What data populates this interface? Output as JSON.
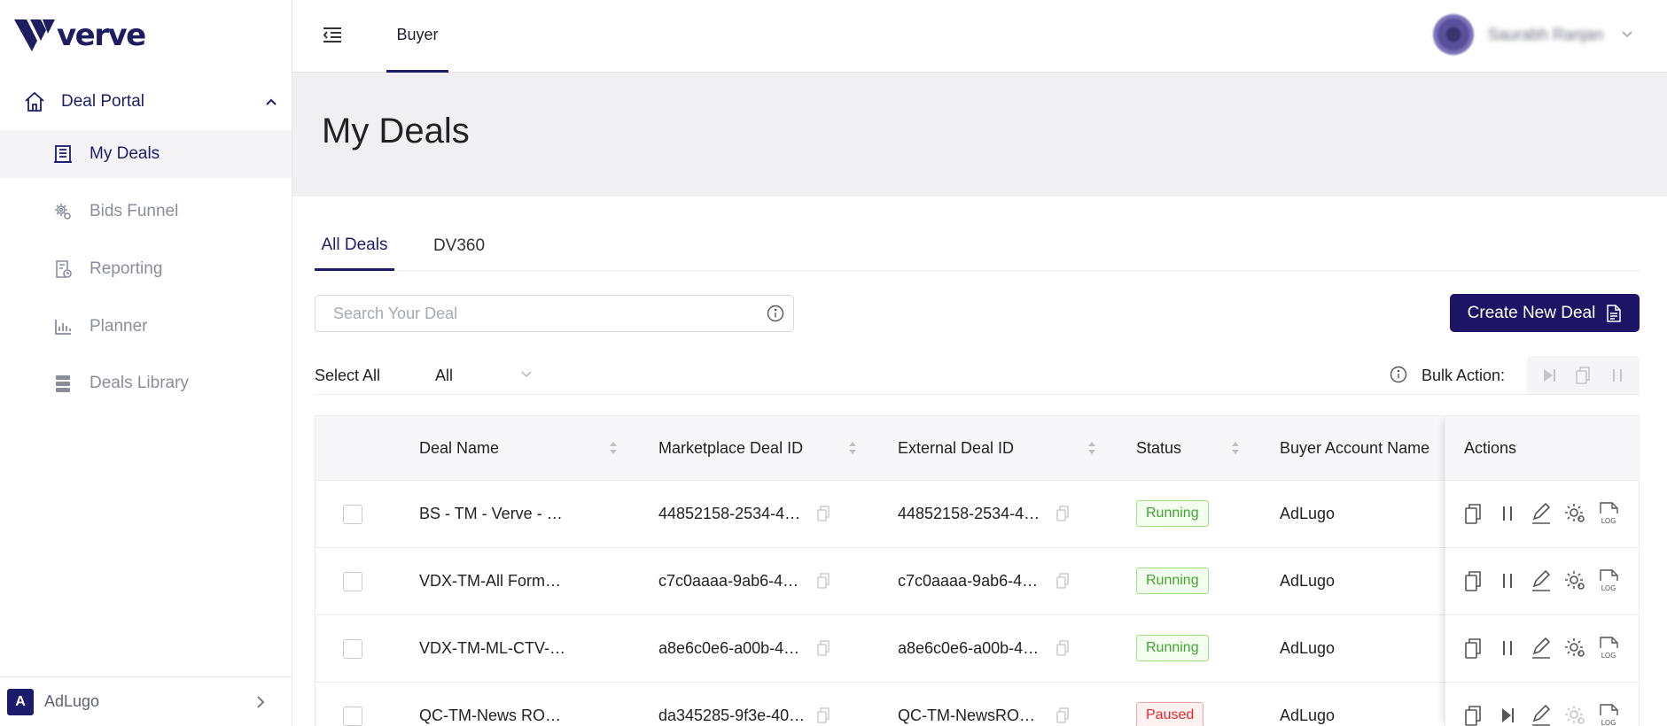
{
  "brand": {
    "name": "verve"
  },
  "sidebar": {
    "section": "Deal Portal",
    "items": [
      {
        "label": "My Deals",
        "icon": "building-icon",
        "active": true
      },
      {
        "label": "Bids Funnel",
        "icon": "gear-cluster-icon",
        "active": false
      },
      {
        "label": "Reporting",
        "icon": "report-icon",
        "active": false
      },
      {
        "label": "Planner",
        "icon": "bar-chart-icon",
        "active": false
      },
      {
        "label": "Deals Library",
        "icon": "server-stack-icon",
        "active": false
      }
    ],
    "account": {
      "initial": "A",
      "name": "AdLugo"
    }
  },
  "topbar": {
    "tab": "Buyer",
    "user_name": "Saurabh Ranjan"
  },
  "page": {
    "title": "My Deals"
  },
  "tabs": [
    {
      "label": "All Deals",
      "active": true
    },
    {
      "label": "DV360",
      "active": false
    }
  ],
  "search": {
    "placeholder": "Search Your Deal"
  },
  "create_button": "Create New Deal",
  "filters": {
    "select_all": "Select All",
    "selected": "All",
    "bulk_label": "Bulk Action:"
  },
  "table": {
    "columns": [
      "Deal Name",
      "Marketplace Deal ID",
      "External Deal ID",
      "Status",
      "Buyer Account Name",
      "Actions"
    ],
    "rows": [
      {
        "deal_name": "BS - TM - Verve - …",
        "marketplace_id": "44852158-2534-4…",
        "external_id": "44852158-2534-4…",
        "status": "Running",
        "buyer": "AdLugo"
      },
      {
        "deal_name": "VDX-TM-All Form…",
        "marketplace_id": "c7c0aaaa-9ab6-4…",
        "external_id": "c7c0aaaa-9ab6-4…",
        "status": "Running",
        "buyer": "AdLugo"
      },
      {
        "deal_name": "VDX-TM-ML-CTV-…",
        "marketplace_id": "a8e6c0e6-a00b-4…",
        "external_id": "a8e6c0e6-a00b-4…",
        "status": "Running",
        "buyer": "AdLugo"
      },
      {
        "deal_name": "QC-TM-News RO…",
        "marketplace_id": "da345285-9f3e-40…",
        "external_id": "QC-TM-NewsRO…",
        "status": "Paused",
        "buyer": "AdLugo"
      }
    ]
  },
  "colors": {
    "brand": "#1d1b6b",
    "primary_button": "#1d1466",
    "running": "#3fa52e",
    "paused": "#e0282e"
  }
}
